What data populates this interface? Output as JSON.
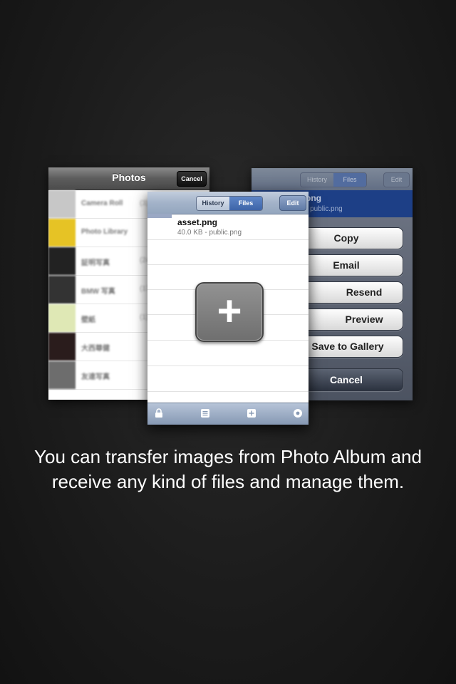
{
  "left_screen": {
    "title": "Photos",
    "cancel_label": "Cancel",
    "albums": [
      {
        "label": "Camera Roll",
        "count": "(3)",
        "thumb": "#c7c7c7"
      },
      {
        "label": "Photo Library",
        "count": "",
        "thumb": "#e6c325"
      },
      {
        "label": "証明写真",
        "count": "(24)",
        "thumb": "#222222"
      },
      {
        "label": "BMW 写真",
        "count": "(170)",
        "thumb": "#333333"
      },
      {
        "label": "壁紙",
        "count": "(1)",
        "thumb": "#dfe8b5"
      },
      {
        "label": "大西尊健",
        "count": "",
        "thumb": "#2a1c1c"
      },
      {
        "label": "友達写真",
        "count": "",
        "thumb": "#6d6d6d"
      }
    ]
  },
  "right_screen": {
    "tabs": [
      "History",
      "Files"
    ],
    "edit_label": "Edit",
    "file_name_fragment": "png",
    "file_meta_fragment": "- public.png",
    "actions": [
      "Copy",
      "Email",
      "Resend",
      "Preview",
      "Save to Gallery"
    ],
    "cancel_label": "Cancel"
  },
  "center_screen": {
    "tabs": [
      "History",
      "Files"
    ],
    "edit_label": "Edit",
    "file_name": "asset.png",
    "file_meta": "40.0 KB - public.png",
    "add_symbol": "+",
    "tabbar_icons": [
      "lock-icon",
      "list-icon",
      "add-icon",
      "info-icon"
    ]
  },
  "caption": "You can transfer images from Photo Album and receive any kind of files and manage them."
}
